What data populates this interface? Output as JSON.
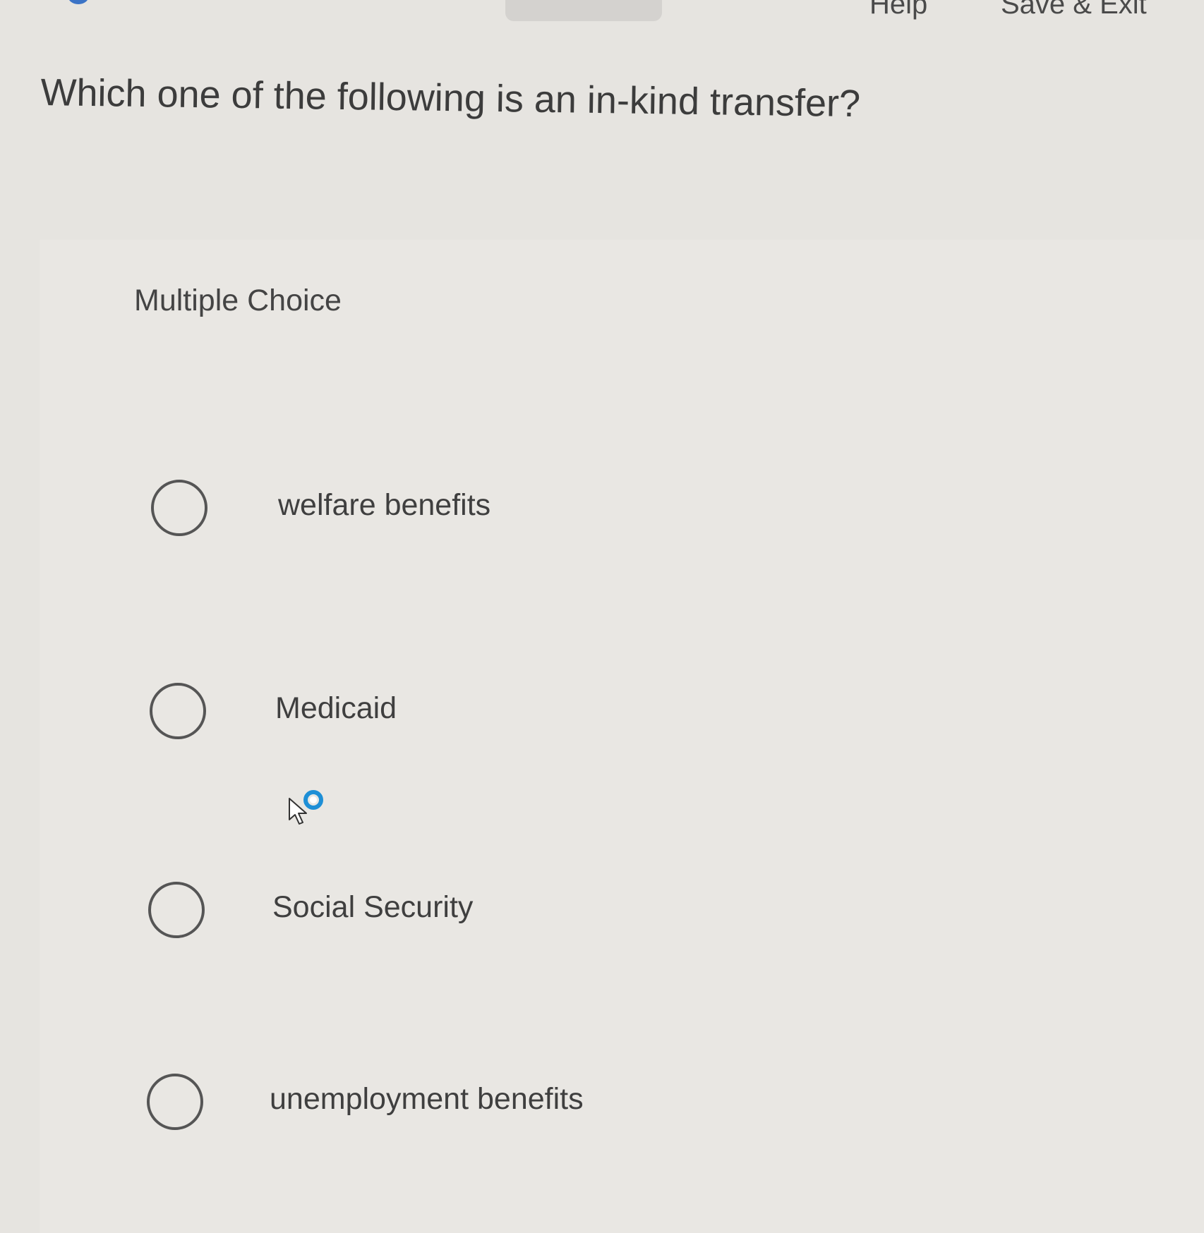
{
  "header": {
    "help_label": "Help",
    "save_exit_label": "Save & Exit"
  },
  "question": {
    "text": "Which one of the following is an in-kind transfer?"
  },
  "choice_panel": {
    "label": "Multiple Choice",
    "options": [
      {
        "label": "welfare benefits",
        "selected": false
      },
      {
        "label": "Medicaid",
        "selected": false
      },
      {
        "label": "Social Security",
        "selected": false
      },
      {
        "label": "unemployment benefits",
        "selected": false
      }
    ]
  },
  "colors": {
    "background": "#e6e4e0",
    "text": "#3c3c3c",
    "radio_border": "#555555",
    "cursor_accent": "#1e8fd6"
  }
}
